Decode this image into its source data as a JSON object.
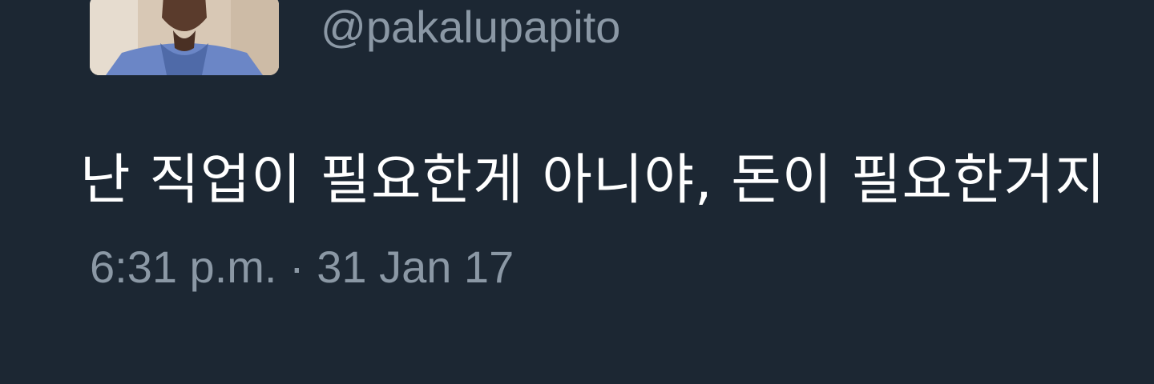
{
  "tweet": {
    "handle": "@pakalupapito",
    "text": "난 직업이 필요한게 아니야, 돈이 필요한거지",
    "timestamp": "6:31 p.m. · 31 Jan 17"
  },
  "theme": {
    "background": "#1c2733",
    "secondary_text": "#8b98a5",
    "primary_text": "#ffffff"
  }
}
